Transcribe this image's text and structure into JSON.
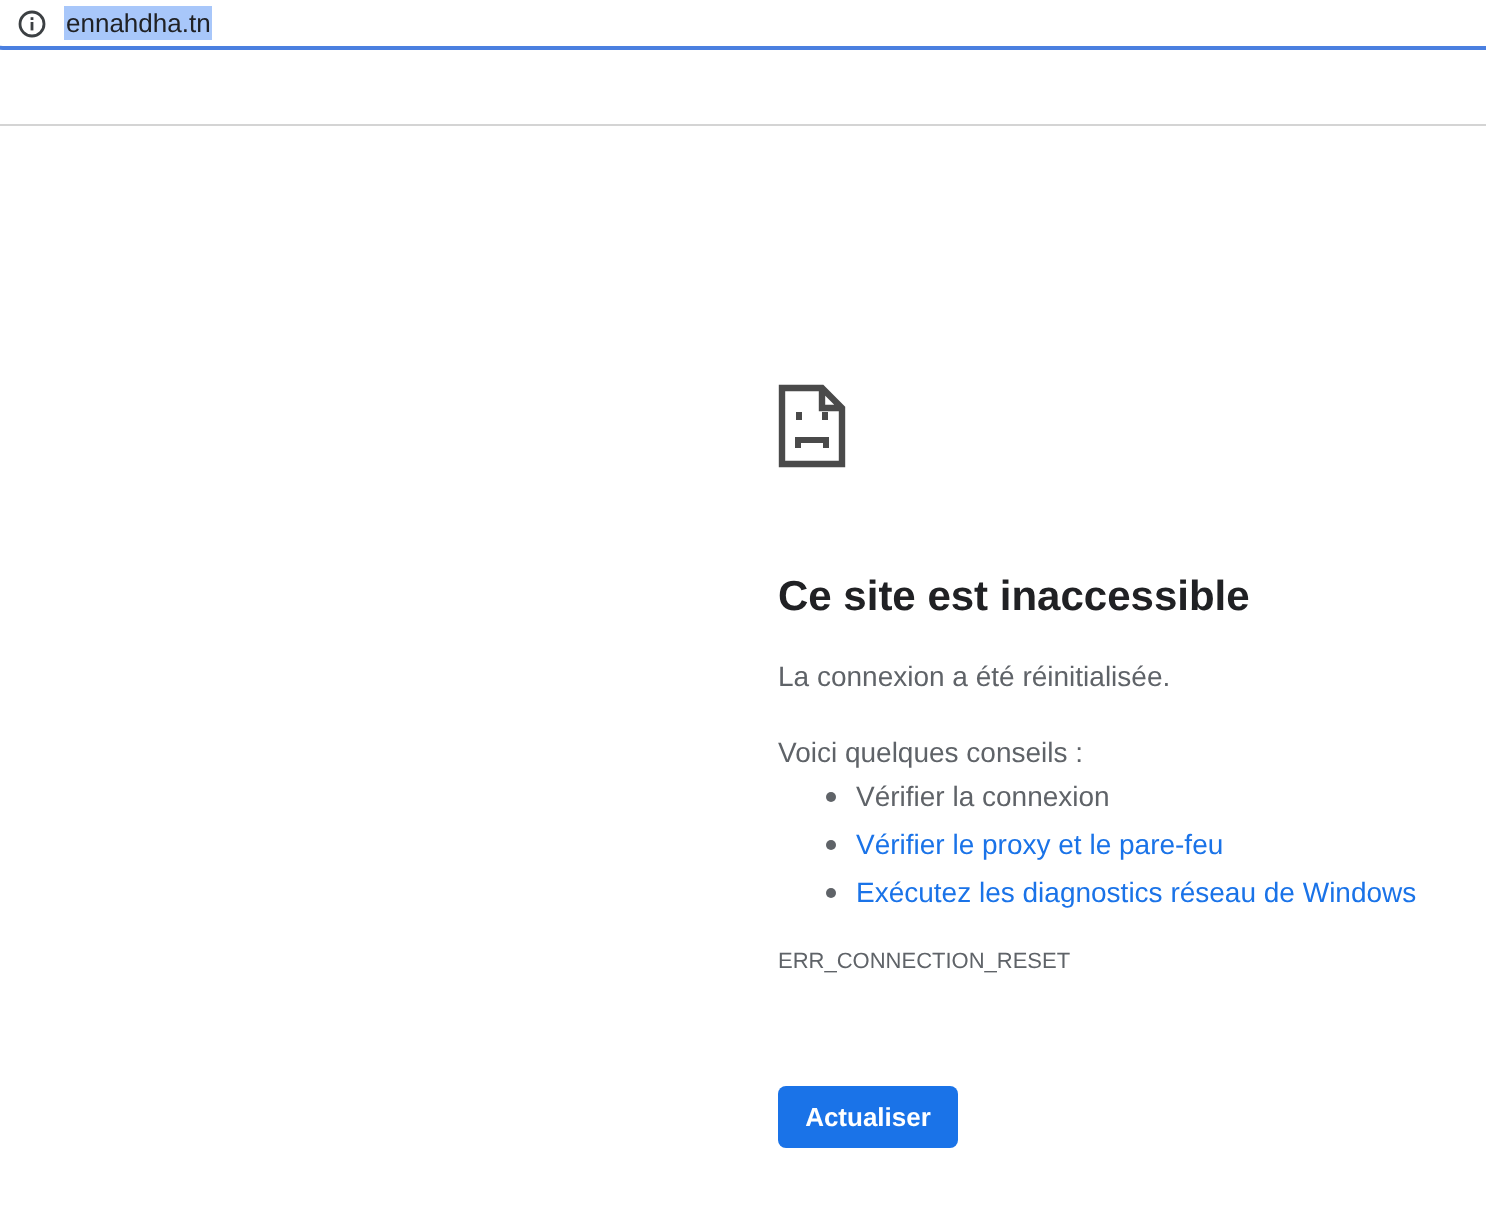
{
  "address_bar": {
    "url": "ennahdha.tn",
    "url_selected": true
  },
  "error_page": {
    "title": "Ce site est inaccessible",
    "message": "La connexion a été réinitialisée.",
    "tips_heading": "Voici quelques conseils :",
    "tips": [
      {
        "text": "Vérifier la connexion",
        "kind": "text"
      },
      {
        "text": "Vérifier le proxy et le pare-feu",
        "kind": "link"
      },
      {
        "text": "Exécutez les diagnostics réseau de Windows",
        "kind": "link"
      }
    ],
    "error_code": "ERR_CONNECTION_RESET",
    "reload_button": "Actualiser"
  }
}
